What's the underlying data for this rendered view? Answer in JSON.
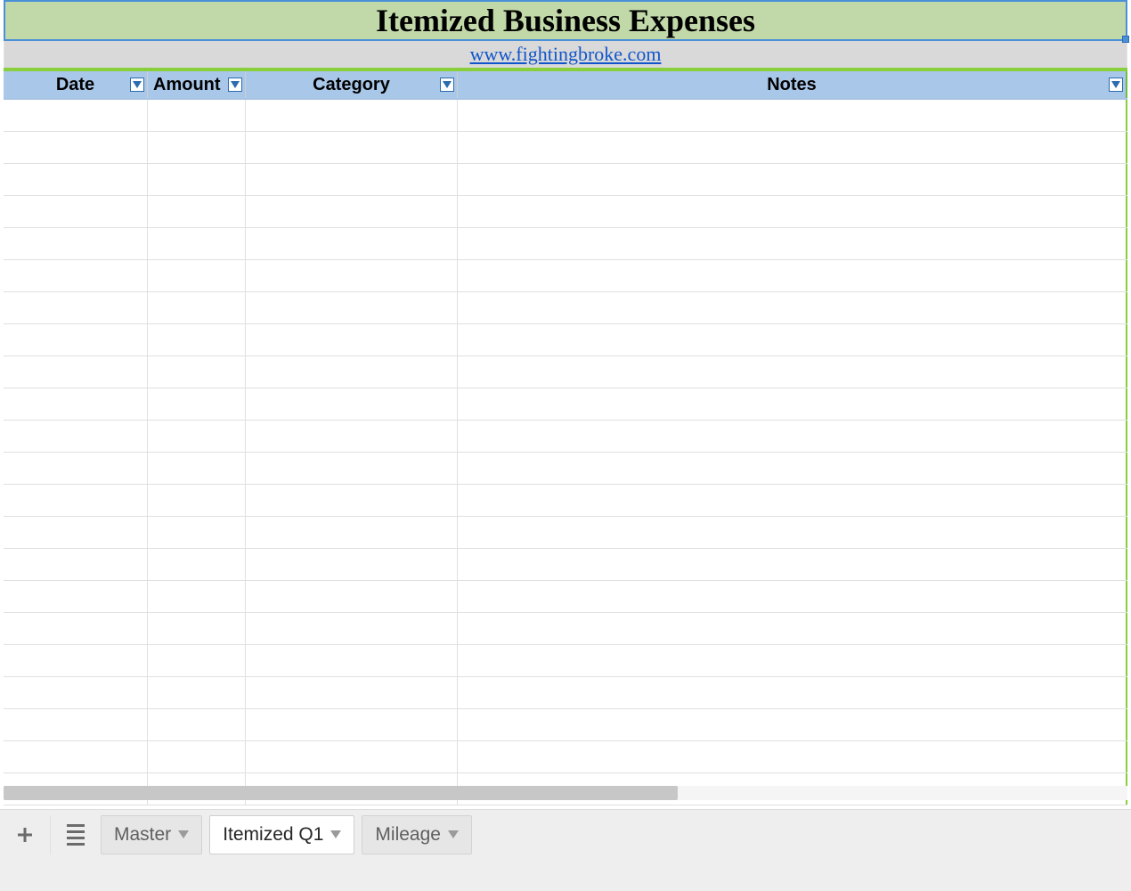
{
  "title": "Itemized Business Expenses",
  "subtitle_link_text": "www.fightingbroke.com",
  "columns": {
    "date": "Date",
    "amount": "Amount",
    "category": "Category",
    "notes": "Notes"
  },
  "empty_row_count": 22,
  "sheet_tabs": {
    "master": "Master",
    "itemized": "Itemized Q1",
    "mileage": "Mileage",
    "active": "itemized"
  }
}
